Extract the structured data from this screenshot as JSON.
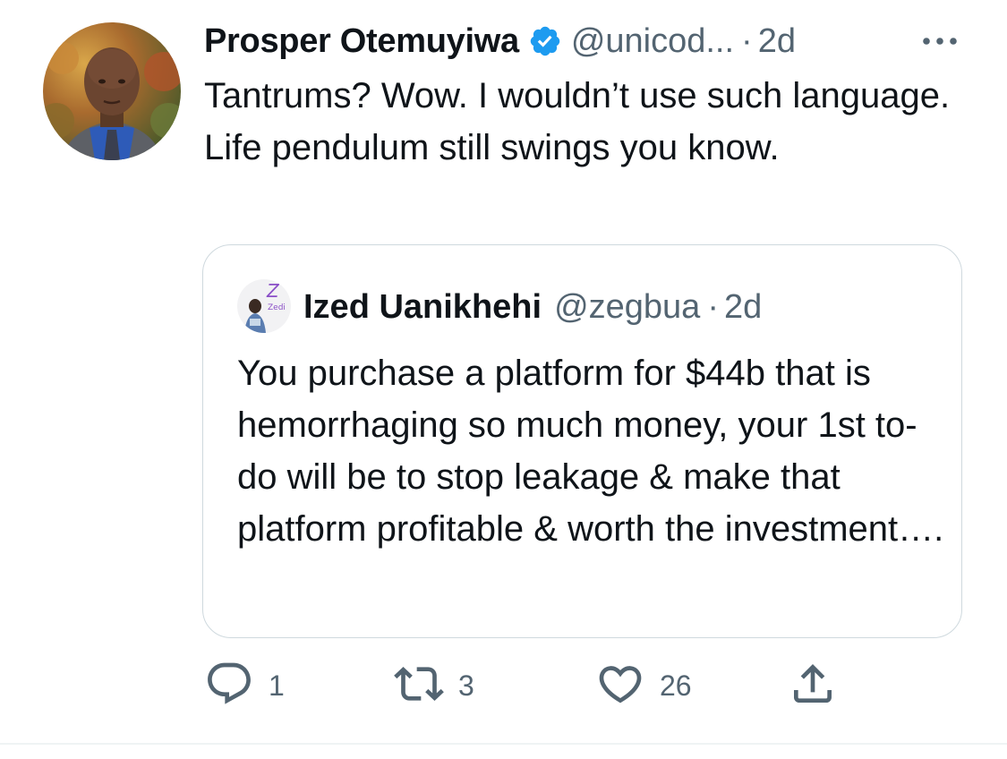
{
  "tweet": {
    "author_name": "Prosper Otemuyiwa",
    "author_handle": "@unicod...",
    "separator": "·",
    "time": "2d",
    "text": "Tantrums? Wow. I wouldn’t use such language. Life pendulum still swings you know.",
    "verified": true,
    "avatar_icon": "profile-photo",
    "more_icon": "more-horizontal-icon"
  },
  "quoted_tweet": {
    "author_name": "Ized Uanikhehi",
    "author_handle": "@zegbua",
    "separator": "·",
    "time": "2d",
    "text": "You purchase a platform for $44b that is hemorrhaging so much money, your 1st to-do will be to stop leakage & make that platform profitable & worth the investment….",
    "avatar_label": "Zedi"
  },
  "actions": {
    "reply_count": "1",
    "retweet_count": "3",
    "like_count": "26"
  },
  "colors": {
    "text": "#0f1419",
    "secondary": "#536471",
    "verified": "#1d9bf0",
    "border": "#cfd9de"
  }
}
